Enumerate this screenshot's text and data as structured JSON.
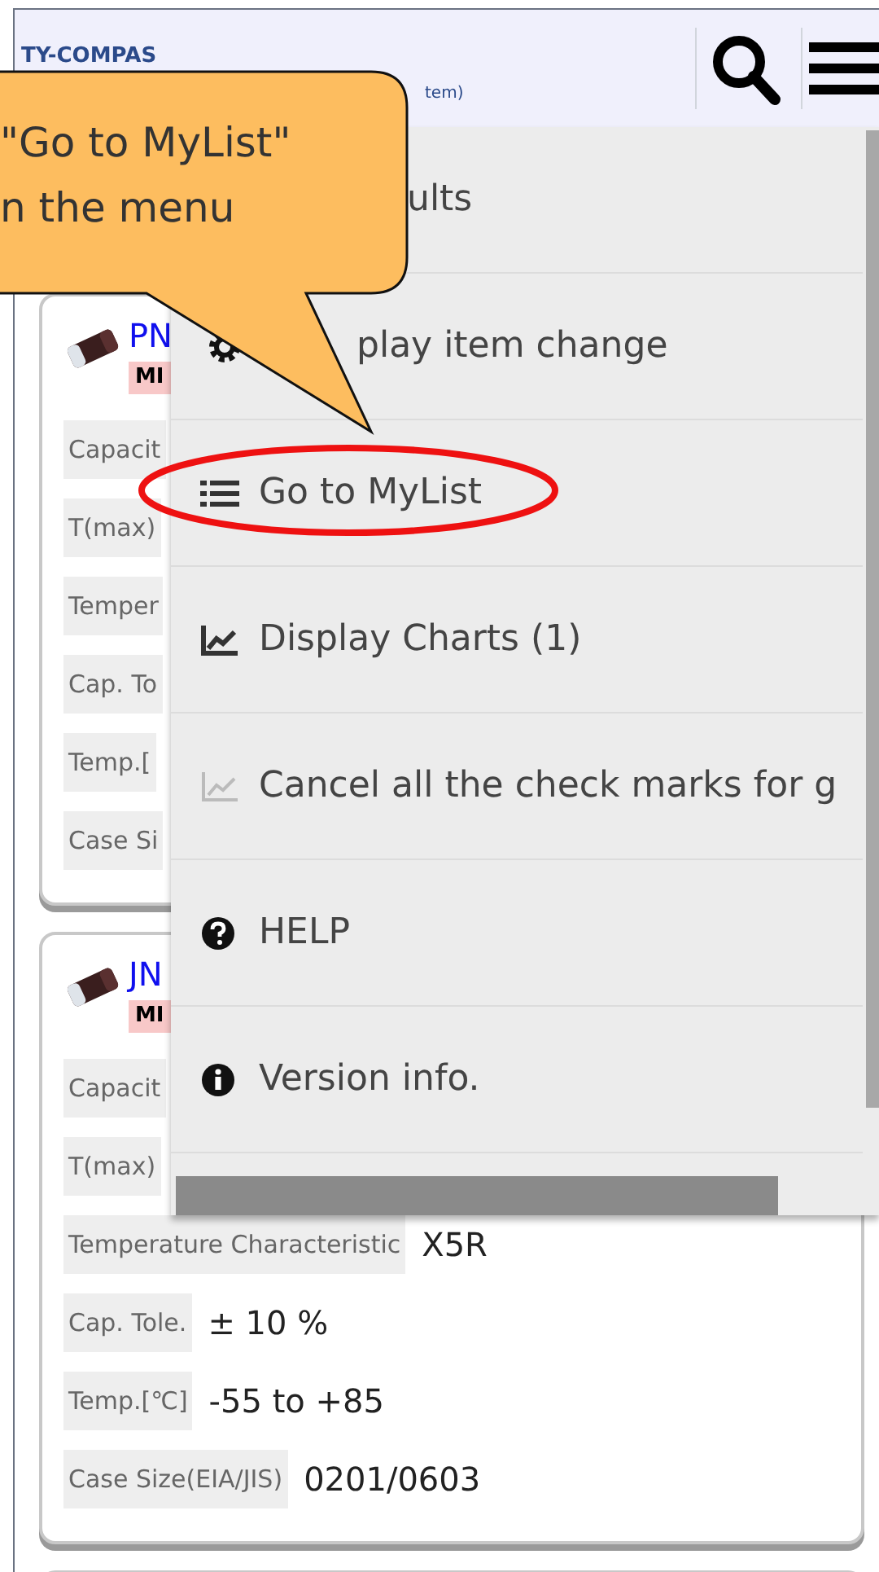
{
  "header": {
    "logo": "TY-COMPAS",
    "subtitle": "tem)"
  },
  "cards": [
    {
      "part_number": "PN",
      "tag": "MI",
      "specs": [
        {
          "label": "Capacit"
        },
        {
          "label": "T(max)"
        },
        {
          "label": "Temper"
        },
        {
          "label": "Cap. To"
        },
        {
          "label": "Temp.["
        },
        {
          "label": "Case Si"
        }
      ]
    },
    {
      "part_number": "JN",
      "tag": "MI",
      "specs": [
        {
          "label": "Capacit"
        },
        {
          "label": "T(max)"
        },
        {
          "label": "Temperature Characteristic",
          "value": "X5R"
        },
        {
          "label": "Cap. Tole.",
          "value": "± 10 %"
        },
        {
          "label": "Temp.[℃]",
          "value": "-55 to +85"
        },
        {
          "label": "Case Size(EIA/JIS)",
          "value": "0201/0603"
        }
      ]
    }
  ],
  "menu": {
    "items": [
      {
        "label": "ults",
        "kind": "covered"
      },
      {
        "label": "play item change",
        "kind": "partly_covered"
      },
      {
        "label": "Go to MyList",
        "kind": "icon"
      },
      {
        "label": "Display Charts (1)",
        "kind": "icon"
      },
      {
        "label": "Cancel all the check marks for g",
        "kind": "icon"
      },
      {
        "label": "HELP",
        "kind": "icon"
      },
      {
        "label": "Version info.",
        "kind": "icon"
      }
    ]
  },
  "callout": {
    "lines": [
      "\"Go to MyList\"",
      "n the menu"
    ]
  }
}
